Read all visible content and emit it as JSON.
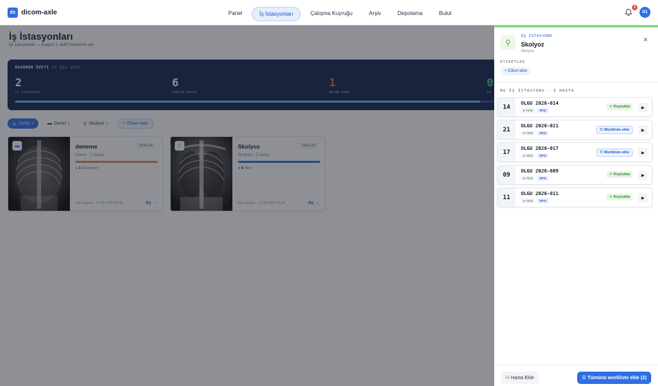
{
  "brand": {
    "logo": "dx",
    "name": "dicom-axle"
  },
  "nav": [
    {
      "label": "Panel"
    },
    {
      "label": "İş İstasyonları"
    },
    {
      "label": "Çalışma Kuyruğu"
    },
    {
      "label": "Arşiv"
    },
    {
      "label": "Depolama"
    },
    {
      "label": "Bulut"
    }
  ],
  "header": {
    "notifications": "2",
    "avatar": "D1"
  },
  "page": {
    "title": "İş İstasyonları",
    "subtitle": "İyi çalışmalar — bugün 1 aktif inceleme var."
  },
  "summary": {
    "heading": "BUGÜNÜN ÖZETİ",
    "date": "19 Ağu 2026",
    "stats": [
      {
        "value": "2",
        "label": "iş istasyonu",
        "color": "#ffffff"
      },
      {
        "value": "6",
        "label": "toplam hasta",
        "color": "#ffffff"
      },
      {
        "value": "1",
        "label": "devam eden",
        "color": "#e46a3c"
      },
      {
        "value": "0",
        "label": "ta",
        "color": "#3fc48a"
      }
    ],
    "progress": 0.97
  },
  "filters": [
    {
      "label": "Tümü",
      "count": "2"
    },
    {
      "label": "Genel",
      "count": "1"
    },
    {
      "label": "Skolyoz",
      "count": "1"
    },
    {
      "label": "Etiket ekle"
    }
  ],
  "cards": [
    {
      "title": "deneme",
      "date": "Tarih yok",
      "sub": "Genel · 1 hasta",
      "bar_color": "#e0875d",
      "stat_num": "1",
      "stat_label": "Okunuyor",
      "foot": "Son açılma · 17.08.2026 09:56",
      "open": "Aç →",
      "icon_color": "#2f6fe4"
    },
    {
      "title": "Skolyoz",
      "date": "Tarih yok",
      "sub": "Skolyoz · 5 hasta",
      "bar_color": "#2f6fe4",
      "stat_num": "5",
      "stat_label": "Yeni",
      "foot": "Son açılma · 17.08.2026 09:54",
      "open": "Aç →",
      "icon_color": "#6fc45a"
    }
  ],
  "panel": {
    "kicker": "İŞ İSTASYONU",
    "title": "Skolyoz",
    "subtitle": "Skolyoz",
    "tags_heading": "ETİKETLER",
    "tag_add": "+ Etiket ekle",
    "list_heading": "BU İŞ İSTASYONU · 5 HASTA",
    "rows": [
      {
        "num": "14",
        "name": "OLGU 2026-014",
        "new": "● YENİ",
        "modality": "RTG",
        "action": "Kuyrukta",
        "kind": "green"
      },
      {
        "num": "21",
        "name": "OLGU 2026-021",
        "new": "● YENİ",
        "modality": "RTG",
        "action": "Workliste ekle",
        "kind": "blue"
      },
      {
        "num": "17",
        "name": "OLGU 2026-017",
        "new": "● YENİ",
        "modality": "RTG",
        "action": "Workliste ekle",
        "kind": "blue"
      },
      {
        "num": "09",
        "name": "OLGU 2026-009",
        "new": "● YENİ",
        "modality": "RTG",
        "action": "Kuyrukta",
        "kind": "green"
      },
      {
        "num": "11",
        "name": "OLGU 2026-011",
        "new": "● YENİ",
        "modality": "RTG",
        "action": "Kuyrukta",
        "kind": "green"
      }
    ],
    "btn_add": "Hasta Ekle",
    "btn_all": "Tümünü workliste ekle (2)"
  }
}
